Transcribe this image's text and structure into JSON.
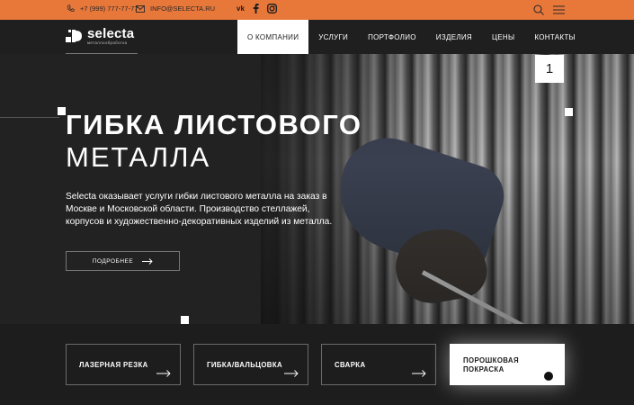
{
  "topbar": {
    "phone": "+7 (999) 777-77-77",
    "email": "INFO@SELECTA.RU",
    "accent_color": "#e8773a",
    "socials": [
      "vk-icon",
      "facebook-icon",
      "instagram-icon"
    ]
  },
  "header": {
    "logo_word": "selecta",
    "logo_sub": "металлообработка",
    "menu": [
      {
        "label": "О КОМПАНИИ",
        "active": true
      },
      {
        "label": "УСЛУГИ",
        "active": false
      },
      {
        "label": "ПОРТФОЛИО",
        "active": false
      },
      {
        "label": "ИЗДЕЛИЯ",
        "active": false
      },
      {
        "label": "ЦЕНЫ",
        "active": false
      },
      {
        "label": "КОНТАКТЫ",
        "active": false
      }
    ]
  },
  "hero": {
    "title_line1": "ГИБКА ЛИСТОВОГО",
    "title_line2": "МЕТАЛЛА",
    "description": "Selecta оказывает услуги гибки листового металла на заказ в Москве и Московской области. Производство стеллажей, корпусов и художественно-декоративных изделий из металла.",
    "more_button": "ПОДРОБНЕЕ",
    "slide_number": "1"
  },
  "services": [
    {
      "label": "ЛАЗЕРНАЯ РЕЗКА",
      "active": false
    },
    {
      "label": "ГИБКА/ВАЛЬЦОВКА",
      "active": false
    },
    {
      "label": "СВАРКА",
      "active": false
    },
    {
      "label": "ПОРОШКОВАЯ ПОКРАСКА",
      "active": true
    }
  ]
}
